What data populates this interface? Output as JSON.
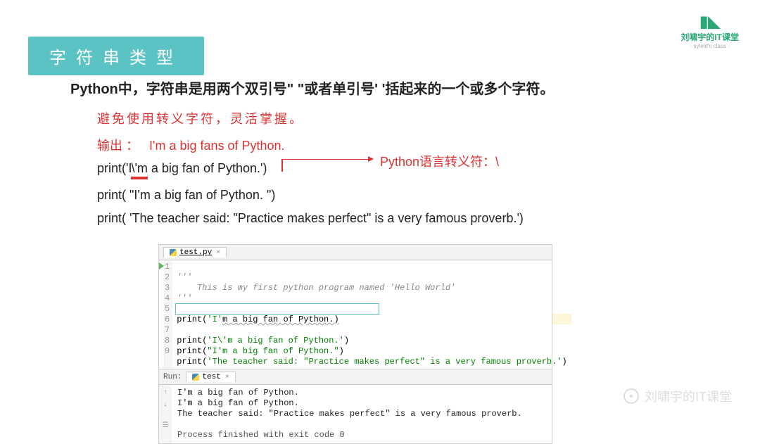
{
  "logo": {
    "mark": "▮◣",
    "text": "刘啸宇的IT课堂",
    "sub": "· syield's class ·"
  },
  "title": "字符串类型",
  "intro": "Python中，字符串是用两个双引号\" \"或者单引号' '括起来的一个或多个字符。",
  "note": "避免使用转义字符，灵活掌握。",
  "output_label": "输出 ：",
  "output_value": "I'm a big fans of Python.",
  "code_lines": {
    "l1_pre": "print('I",
    "l1_mid": "\\'m",
    "l1_post": " a big fan of Python.')",
    "l2": "print( \"I'm a big fan of Python. \")",
    "l3": "print( 'The teacher said: \"Practice makes perfect\" is a very famous proverb.')"
  },
  "callout": "Python语言转义符：\\",
  "ide": {
    "tab": "test.py",
    "run_tab": "Run:",
    "run_name": "test",
    "lines": {
      "l1": "'''",
      "l2": "    This is my first python program named 'Hello World'",
      "l3": "'''",
      "l5a": "print(",
      "l5b": "'I'",
      "l5c": "m a big fan of Python.)",
      "l7a": "print(",
      "l7b": "'I\\'m a big fan of Python.'",
      "l7c": ")",
      "l8a": "print(",
      "l8b": "\"I'm a big fan of Python.\"",
      "l8c": ")",
      "l9a": "print(",
      "l9b": "'The teacher said: \"Practice makes perfect\" is a very famous proverb.'",
      "l9c": ")"
    },
    "console": {
      "o1": "I'm a big fan of Python.",
      "o2": "I'm a big fan of Python.",
      "o3": "The teacher said: \"Practice makes perfect\" is a very famous proverb.",
      "exit": "Process finished with exit code 0"
    }
  },
  "watermark": "刘啸宇的IT课堂"
}
